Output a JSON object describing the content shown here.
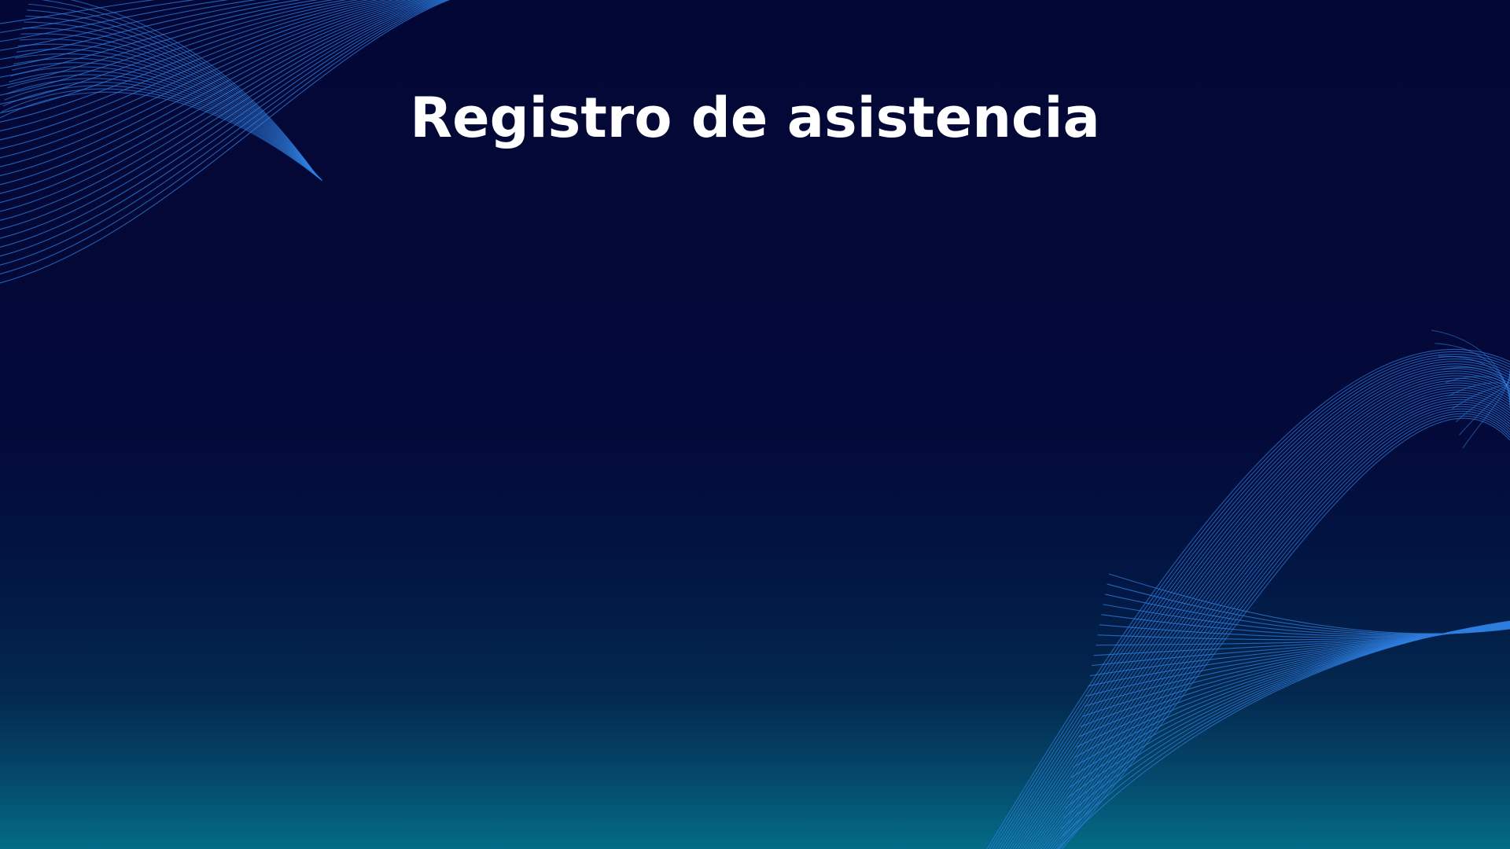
{
  "slide": {
    "title": "Registro de asistencia",
    "decorations": [
      "wave-lines-top-left",
      "wave-lines-bottom-right"
    ]
  },
  "colors": {
    "background_top": "#030736",
    "background_bottom": "#046c86",
    "wave_line": "#2f7fe0",
    "title_text": "#ffffff"
  }
}
